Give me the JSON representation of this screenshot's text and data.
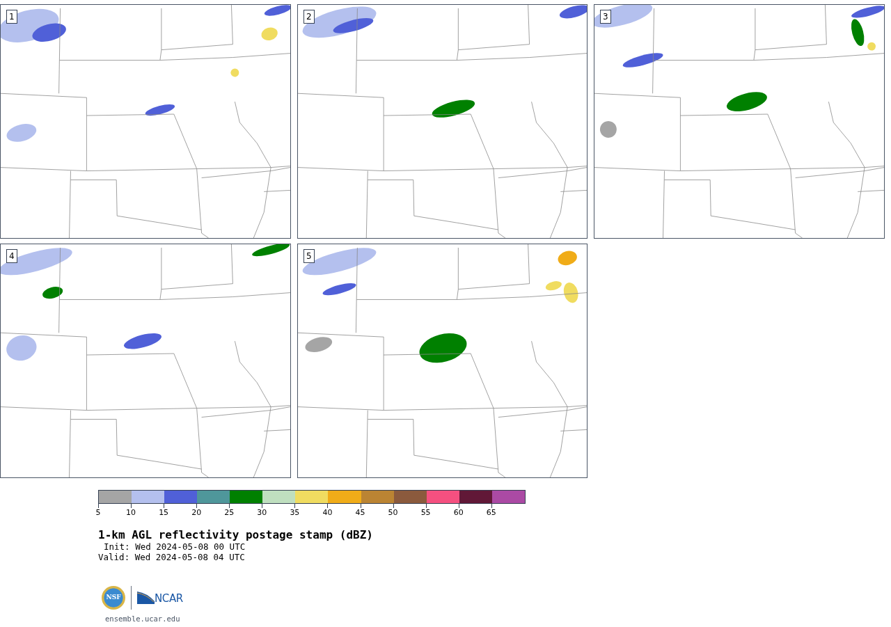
{
  "panels": [
    {
      "number": "1"
    },
    {
      "number": "2"
    },
    {
      "number": "3"
    },
    {
      "number": "4"
    },
    {
      "number": "5"
    }
  ],
  "colorbar": {
    "segments": [
      {
        "color": "#a5a5a5"
      },
      {
        "color": "#b4c0ee"
      },
      {
        "color": "#5060d8"
      },
      {
        "color": "#4f979b"
      },
      {
        "color": "#008000"
      },
      {
        "color": "#bfdfbf"
      },
      {
        "color": "#f0dc60"
      },
      {
        "color": "#f0ac18"
      },
      {
        "color": "#bb8433"
      },
      {
        "color": "#8b5a3d"
      },
      {
        "color": "#f55080"
      },
      {
        "color": "#611837"
      },
      {
        "color": "#ab4aa4"
      }
    ],
    "labels": [
      "5",
      "10",
      "15",
      "20",
      "25",
      "30",
      "35",
      "40",
      "45",
      "50",
      "55",
      "60",
      "65"
    ]
  },
  "title": "1-km AGL reflectivity postage stamp (dBZ)",
  "init": "Init: Wed 2024-05-08 00 UTC",
  "valid": "Valid: Wed 2024-05-08 04 UTC",
  "logos": {
    "nsf": "NSF",
    "ncar": "NCAR"
  },
  "footer": "ensemble.ucar.edu"
}
